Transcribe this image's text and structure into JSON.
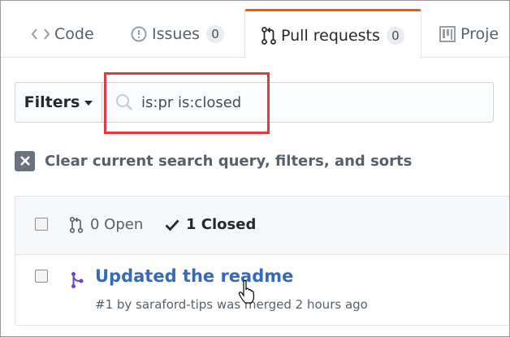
{
  "tabs": {
    "code": {
      "label": "Code"
    },
    "issues": {
      "label": "Issues",
      "count": "0"
    },
    "pull_requests": {
      "label": "Pull requests",
      "count": "0"
    },
    "projects": {
      "label": "Proje"
    }
  },
  "filters": {
    "button_label": "Filters",
    "search_value": "is:pr is:closed"
  },
  "clear_query": {
    "label": "Clear current search query, filters, and sorts"
  },
  "list": {
    "open_state": "0 Open",
    "closed_state": "1 Closed",
    "items": [
      {
        "title": "Updated the readme",
        "meta": "#1 by saraford-tips was merged 2 hours ago"
      }
    ]
  },
  "colors": {
    "selected_tab_accent": "#e36209",
    "highlight_box": "#e33a3f",
    "link_blue": "#366ab7",
    "merged_purple": "#6f42c1"
  },
  "icons": {
    "code_tab": "code-icon",
    "issues_tab": "issue-opened-icon",
    "pr_tab": "git-pull-request-icon",
    "projects_tab": "project-icon",
    "search": "search-icon",
    "clear": "x-icon",
    "closed_check": "check-icon",
    "merged": "git-merge-icon"
  }
}
